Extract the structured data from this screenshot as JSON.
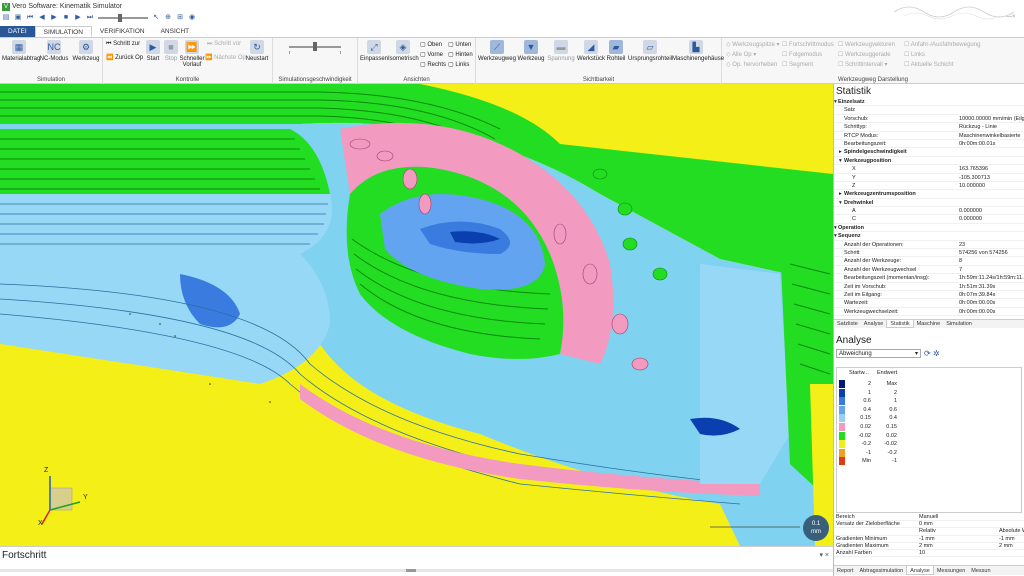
{
  "app": {
    "title": "Vero Software: Kinematik Simulator"
  },
  "tabs": [
    "DATEI",
    "SIMULATION",
    "VERIFIKATION",
    "ANSICHT"
  ],
  "ribbon": {
    "simulation": {
      "label": "Simulation",
      "buttons": [
        "Materialabtrag",
        "NC-Modus",
        "Werkzeug"
      ]
    },
    "kontrolle": {
      "label": "Kontrolle",
      "small": [
        "Schritt zur",
        "Zurück Op"
      ],
      "buttons": [
        "Start",
        "Stop",
        "Schneller",
        "Vorlauf",
        "Neustart"
      ],
      "dim": [
        "Schritt vor",
        "Nächste Op"
      ]
    },
    "speed": {
      "label": "Simulationsgeschwindigkeit"
    },
    "ansichten": {
      "label": "Ansichten",
      "buttons": [
        "Einpassen",
        "Isometrisch"
      ],
      "views": [
        "Oben",
        "Vorne",
        "Rechts",
        "Unten",
        "Hinten",
        "Links"
      ]
    },
    "sichtbarkeit": {
      "label": "Sichtbarkeit",
      "buttons": [
        "Werkzeugweg",
        "Werkzeug",
        "Spannung",
        "Werkstück",
        "Rohteil",
        "Ursprungsrohteil",
        "Maschinengehäuse"
      ]
    },
    "wzd": {
      "label": "Werkzeugweg Darstellung",
      "items": [
        "Werkzeugspitze",
        "Alle Op",
        "Op. hervorheben",
        "Fortschrittmodus",
        "Folgemodus",
        "Segment",
        "Werkzeugvektoren",
        "Werkzeuggerade",
        "Schrittintervall",
        "Anfahr-/Ausfahrbewegung",
        "Links",
        "Aktuelle Schicht"
      ]
    }
  },
  "viewport": {
    "triad": {
      "z": "Z",
      "y": "Y",
      "x": "X"
    },
    "scale": {
      "value": "0.1",
      "unit": "mm"
    }
  },
  "progress": {
    "title": "Fortschritt",
    "close": "▾ ×"
  },
  "statistik": {
    "title": "Statistik",
    "rows": [
      {
        "k": "Einzelsatz",
        "v": "",
        "t": "hdr"
      },
      {
        "k": "Satz",
        "v": "",
        "t": ""
      },
      {
        "k": "Vorschub:",
        "v": "10000.00000 mm/min (Eilg",
        "t": ""
      },
      {
        "k": "Schrittyp:",
        "v": "Rückzug - Linie",
        "t": ""
      },
      {
        "k": "RTCP Modus:",
        "v": "Maschinenwinkelbasierte",
        "t": ""
      },
      {
        "k": "Bearbeitungszeit:",
        "v": "0h:00m:00.01s",
        "t": ""
      },
      {
        "k": "Spindelgeschwindigkeit",
        "v": "",
        "t": "sub"
      },
      {
        "k": "Werkzeugposition",
        "v": "",
        "t": "sub"
      },
      {
        "k": "X",
        "v": "163.765396",
        "t": "ind"
      },
      {
        "k": "Y",
        "v": "-105.300713",
        "t": "ind"
      },
      {
        "k": "Z",
        "v": "10.000000",
        "t": "ind"
      },
      {
        "k": "Werkzeugzentrumsposition",
        "v": "",
        "t": "sub"
      },
      {
        "k": "Drehwinkel",
        "v": "",
        "t": "sub"
      },
      {
        "k": "A",
        "v": "0.000000",
        "t": "ind"
      },
      {
        "k": "C",
        "v": "0.000000",
        "t": "ind"
      },
      {
        "k": "Operation",
        "v": "",
        "t": "hdr"
      },
      {
        "k": "Sequenz",
        "v": "",
        "t": "hdr"
      },
      {
        "k": "Anzahl der Operationen:",
        "v": "23",
        "t": ""
      },
      {
        "k": "Schritt",
        "v": "574256 von 574256",
        "t": ""
      },
      {
        "k": "Anzahl der Werkzeuge:",
        "v": "8",
        "t": ""
      },
      {
        "k": "Anzahl der Werkzeugwechsel",
        "v": "7",
        "t": ""
      },
      {
        "k": "Bearbeitungszeit (momentan/insg):",
        "v": "1h:59m:11.24s/1h:59m:11.2",
        "t": ""
      },
      {
        "k": "Zeit im Vorschub:",
        "v": "1h:51m:31.39s",
        "t": ""
      },
      {
        "k": "Zeit im Eilgang:",
        "v": "0h:07m:39.84s",
        "t": ""
      },
      {
        "k": "Wartezeit:",
        "v": "0h:00m:00.00s",
        "t": ""
      },
      {
        "k": "Werkzeugwechselzeit:",
        "v": "0h:00m:00.00s",
        "t": ""
      }
    ],
    "tabs": [
      "Satzliste",
      "Analyse",
      "Statistik",
      "Maschine",
      "Simulation"
    ]
  },
  "analyse": {
    "title": "Analyse",
    "mode": "Abweichung",
    "head": [
      "Startw...",
      "Endwert"
    ],
    "legend": [
      {
        "color": "#001a7a",
        "a": "2",
        "b": "Max"
      },
      {
        "color": "#0a3fb0",
        "a": "1",
        "b": "2"
      },
      {
        "color": "#3a7be0",
        "a": "0.6",
        "b": "1"
      },
      {
        "color": "#63a4f0",
        "a": "0.4",
        "b": "0.6"
      },
      {
        "color": "#96d0f5",
        "a": "0.15",
        "b": "0.4"
      },
      {
        "color": "#f29ac0",
        "a": "0.02",
        "b": "0.15"
      },
      {
        "color": "#1ee01e",
        "a": "-0.02",
        "b": "0.02"
      },
      {
        "color": "#f2ee1a",
        "a": "-0.2",
        "b": "-0.02"
      },
      {
        "color": "#f0a020",
        "a": "-1",
        "b": "-0.2"
      },
      {
        "color": "#e03a10",
        "a": "Min",
        "b": "-1"
      }
    ],
    "table": [
      {
        "k": "Bereich",
        "v1": "Manuell",
        "v2": ""
      },
      {
        "k": "Versatz der Zieloberfläche",
        "v1": "0 mm",
        "v2": ""
      },
      {
        "k": "",
        "v1": "Relativ",
        "v2": "Absolute W"
      },
      {
        "k": "Gradienten Minimum",
        "v1": "-1 mm",
        "v2": "-1 mm"
      },
      {
        "k": "Gradienten Maximum",
        "v1": "2 mm",
        "v2": "2 mm"
      },
      {
        "k": "Anzahl Farben",
        "v1": "10",
        "v2": ""
      }
    ],
    "tabs": [
      "Report",
      "Abtragssimulation",
      "Analyse",
      "Messungen",
      "Messun"
    ]
  }
}
